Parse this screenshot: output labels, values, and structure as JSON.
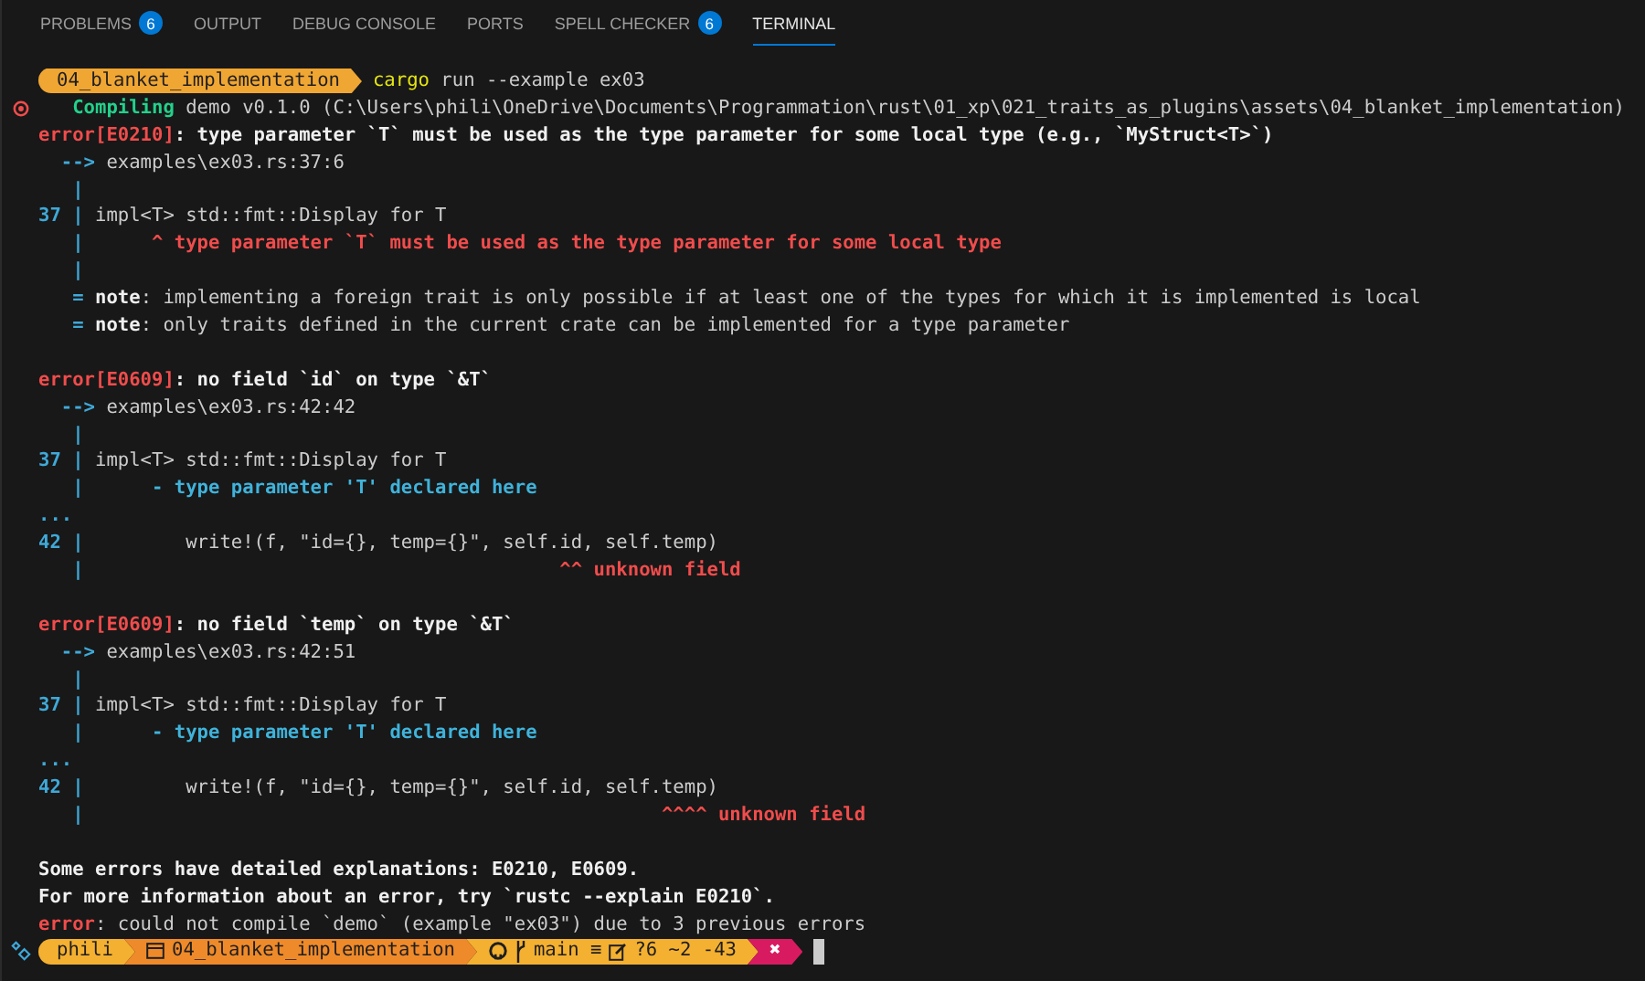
{
  "tabs": [
    {
      "label": "PROBLEMS",
      "badge": "6",
      "selected": false
    },
    {
      "label": "OUTPUT",
      "selected": false
    },
    {
      "label": "DEBUG CONSOLE",
      "selected": false
    },
    {
      "label": "PORTS",
      "selected": false
    },
    {
      "label": "SPELL CHECKER",
      "badge": "6",
      "selected": false
    },
    {
      "label": "TERMINAL",
      "selected": true
    }
  ],
  "terminal": {
    "command_prompt": {
      "path": "04_blanket_implementation",
      "program": "cargo",
      "args": "run --example ex03",
      "failed": true
    },
    "lines": [
      {
        "kind": "text",
        "segments": [
          {
            "kind": "success",
            "text": "   Compiling"
          },
          {
            "kind": "plain",
            "text": " demo v0.1.0 (C:\\Users\\phili\\OneDrive\\Documents\\Programmation\\rust\\01_xp\\021_traits_as_plugins\\assets\\04_blanket_implementation)"
          }
        ]
      },
      {
        "kind": "text",
        "segments": [
          {
            "kind": "error",
            "text": "error[E0210]"
          },
          {
            "kind": "bold",
            "text": ": type parameter `T` must be used as the type parameter for some local type (e.g., `MyStruct<T>`)"
          }
        ]
      },
      {
        "kind": "text",
        "segments": [
          {
            "kind": "gutter",
            "text": "  --> "
          },
          {
            "kind": "plain",
            "text": "examples\\ex03.rs:37:6"
          }
        ]
      },
      {
        "kind": "text",
        "segments": [
          {
            "kind": "gutter",
            "text": "   |"
          }
        ]
      },
      {
        "kind": "text",
        "segments": [
          {
            "kind": "gutter",
            "text": "37 |"
          },
          {
            "kind": "plain",
            "text": " impl<T> std::fmt::Display for T"
          }
        ]
      },
      {
        "kind": "text",
        "segments": [
          {
            "kind": "gutter",
            "text": "   |"
          },
          {
            "kind": "error",
            "text": "      ^ type parameter `T` must be used as the type parameter for some local type"
          }
        ]
      },
      {
        "kind": "text",
        "segments": [
          {
            "kind": "gutter",
            "text": "   |"
          }
        ]
      },
      {
        "kind": "text",
        "segments": [
          {
            "kind": "gutter",
            "text": "   = "
          },
          {
            "kind": "bold",
            "text": "note"
          },
          {
            "kind": "plain",
            "text": ": implementing a foreign trait is only possible if at least one of the types for which it is implemented is local"
          }
        ]
      },
      {
        "kind": "text",
        "segments": [
          {
            "kind": "gutter",
            "text": "   = "
          },
          {
            "kind": "bold",
            "text": "note"
          },
          {
            "kind": "plain",
            "text": ": only traits defined in the current crate can be implemented for a type parameter"
          }
        ]
      },
      {
        "kind": "blank"
      },
      {
        "kind": "text",
        "segments": [
          {
            "kind": "error",
            "text": "error[E0609]"
          },
          {
            "kind": "bold",
            "text": ": no field `id` on type `&T`"
          }
        ]
      },
      {
        "kind": "text",
        "segments": [
          {
            "kind": "gutter",
            "text": "  --> "
          },
          {
            "kind": "plain",
            "text": "examples\\ex03.rs:42:42"
          }
        ]
      },
      {
        "kind": "text",
        "segments": [
          {
            "kind": "gutter",
            "text": "   |"
          }
        ]
      },
      {
        "kind": "text",
        "segments": [
          {
            "kind": "gutter",
            "text": "37 |"
          },
          {
            "kind": "plain",
            "text": " impl<T> std::fmt::Display for T"
          }
        ]
      },
      {
        "kind": "text",
        "segments": [
          {
            "kind": "gutter",
            "text": "   |"
          },
          {
            "kind": "info",
            "text": "      - type parameter 'T' declared here"
          }
        ]
      },
      {
        "kind": "text",
        "segments": [
          {
            "kind": "gutter",
            "text": "..."
          }
        ]
      },
      {
        "kind": "text",
        "segments": [
          {
            "kind": "gutter",
            "text": "42 |"
          },
          {
            "kind": "plain",
            "text": "         write!(f, \"id={}, temp={}\", self.id, self.temp)"
          }
        ]
      },
      {
        "kind": "text",
        "segments": [
          {
            "kind": "gutter",
            "text": "   |"
          },
          {
            "kind": "error",
            "text": "                                          ^^ unknown field"
          }
        ]
      },
      {
        "kind": "blank"
      },
      {
        "kind": "text",
        "segments": [
          {
            "kind": "error",
            "text": "error[E0609]"
          },
          {
            "kind": "bold",
            "text": ": no field `temp` on type `&T`"
          }
        ]
      },
      {
        "kind": "text",
        "segments": [
          {
            "kind": "gutter",
            "text": "  --> "
          },
          {
            "kind": "plain",
            "text": "examples\\ex03.rs:42:51"
          }
        ]
      },
      {
        "kind": "text",
        "segments": [
          {
            "kind": "gutter",
            "text": "   |"
          }
        ]
      },
      {
        "kind": "text",
        "segments": [
          {
            "kind": "gutter",
            "text": "37 |"
          },
          {
            "kind": "plain",
            "text": " impl<T> std::fmt::Display for T"
          }
        ]
      },
      {
        "kind": "text",
        "segments": [
          {
            "kind": "gutter",
            "text": "   |"
          },
          {
            "kind": "info",
            "text": "      - type parameter 'T' declared here"
          }
        ]
      },
      {
        "kind": "text",
        "segments": [
          {
            "kind": "gutter",
            "text": "..."
          }
        ]
      },
      {
        "kind": "text",
        "segments": [
          {
            "kind": "gutter",
            "text": "42 |"
          },
          {
            "kind": "plain",
            "text": "         write!(f, \"id={}, temp={}\", self.id, self.temp)"
          }
        ]
      },
      {
        "kind": "text",
        "segments": [
          {
            "kind": "gutter",
            "text": "   |"
          },
          {
            "kind": "error",
            "text": "                                                   ^^^^ unknown field"
          }
        ]
      },
      {
        "kind": "blank"
      },
      {
        "kind": "text",
        "segments": [
          {
            "kind": "bold",
            "text": "Some errors have detailed explanations: E0210, E0609."
          }
        ]
      },
      {
        "kind": "text",
        "segments": [
          {
            "kind": "bold",
            "text": "For more information about an error, try `rustc --explain E0210`."
          }
        ]
      },
      {
        "kind": "text",
        "segments": [
          {
            "kind": "error",
            "text": "error"
          },
          {
            "kind": "plain",
            "text": ": could not compile `demo` (example \"ex03\") due to 3 previous errors"
          }
        ]
      }
    ],
    "status_prompt": {
      "segments": [
        {
          "kind": "user",
          "text": "phili"
        },
        {
          "kind": "folder",
          "text": "04_blanket_implementation"
        },
        {
          "kind": "git",
          "branch": "main ≡",
          "changes": "?6 ~2 -43"
        },
        {
          "kind": "status",
          "text": "✖"
        }
      ]
    }
  }
}
